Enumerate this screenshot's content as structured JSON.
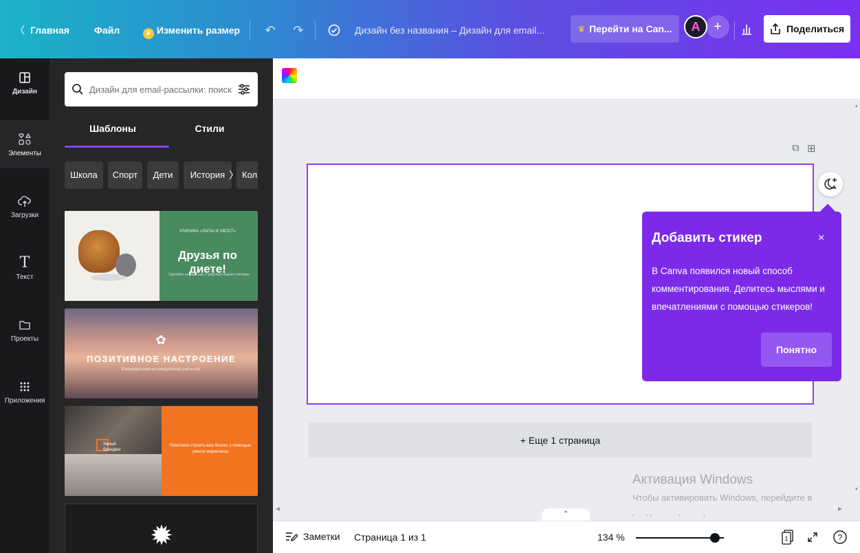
{
  "topbar": {
    "home_label": "Главная",
    "file_label": "Файл",
    "resize_label": "Изменить размер",
    "doc_title": "Дизайн без названия – Дизайн для email...",
    "upgrade_label": "Перейти на Can...",
    "avatar_letter": "A",
    "share_label": "Поделиться"
  },
  "rail": {
    "items": [
      {
        "label": "Дизайн"
      },
      {
        "label": "Элементы"
      },
      {
        "label": "Загрузки"
      },
      {
        "label": "Текст"
      },
      {
        "label": "Проекты"
      },
      {
        "label": "Приложения"
      }
    ]
  },
  "panel": {
    "search_placeholder": "Дизайн для email-рассылки: поиск",
    "tabs": [
      {
        "label": "Шаблоны"
      },
      {
        "label": "Стили"
      }
    ],
    "chips": [
      {
        "label": "Школа"
      },
      {
        "label": "Спорт"
      },
      {
        "label": "Дети"
      },
      {
        "label": "История"
      },
      {
        "label": "Кол"
      }
    ],
    "templates": [
      {
        "brand": "КЛИНИКА «ЛАПЫ И ХВОСТ»",
        "title": "Друзья по диете!",
        "sub": "Сделайте первый шаг к здоровью вашего питомца"
      },
      {
        "title": "ПОЗИТИВНОЕ НАСТРОЕНИЕ",
        "sub": "Еженедельная мотивационная рассылка"
      },
      {
        "logo_text": "Умный брендинг",
        "text": "Помогаем строить ваш бизнес с помощью умного маркетинга"
      }
    ]
  },
  "sticker_popover": {
    "title": "Добавить стикер",
    "close": "×",
    "body": "В Canva появился новый способ комментирования. Делитесь мыслями и впечатлениями с помощью стикеров!",
    "button": "Понятно"
  },
  "editor": {
    "add_page_label": "+ Еще 1 страница"
  },
  "watermark": {
    "title": "Активация Windows",
    "sub": "Чтобы активировать Windows, перейдите в раздел \"Параметры\"."
  },
  "footer": {
    "notes_label": "Заметки",
    "page_info": "Страница 1 из 1",
    "zoom": "134 %",
    "page_count": "1",
    "help": "?"
  },
  "zoom_level": 0.9,
  "colors": {
    "accent": "#8b3dff",
    "popover_bg": "#7d2ae8",
    "panel_bg": "#252627",
    "rail_bg": "#18191b"
  }
}
